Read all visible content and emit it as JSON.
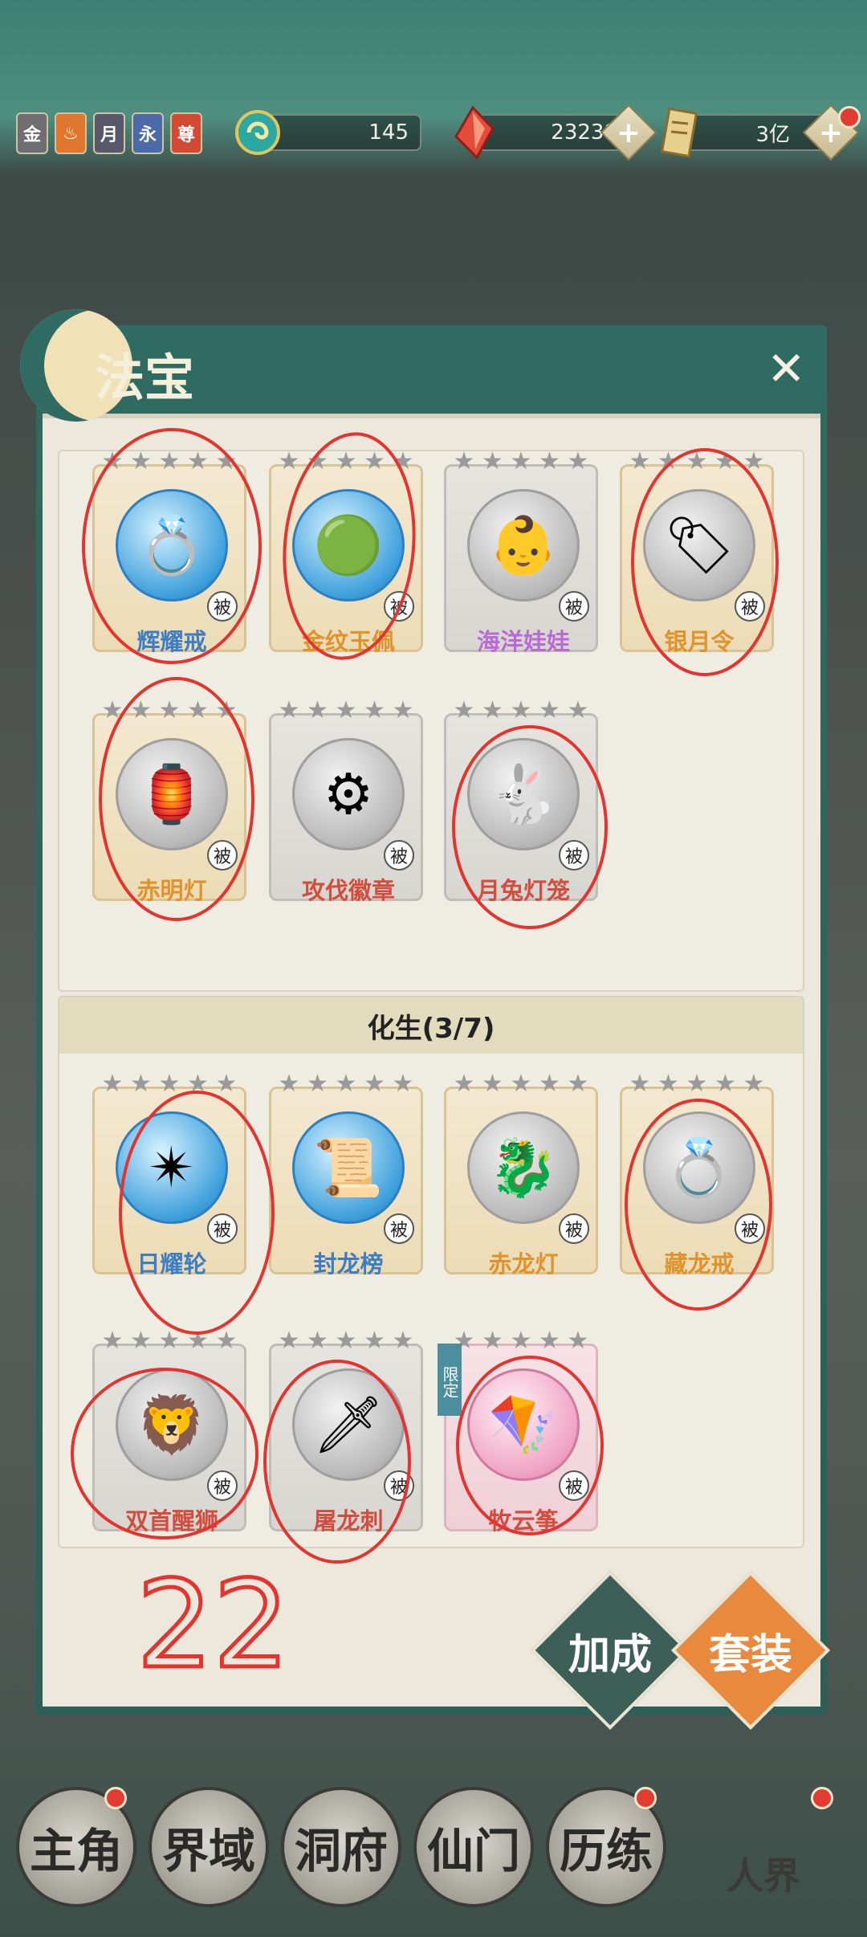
{
  "topbar": {
    "badges": [
      {
        "label": "金",
        "color": "#6f6f72",
        "icon": "gold-badge-icon"
      },
      {
        "label": "♨",
        "color": "#e1772f",
        "icon": "flame-badge-icon"
      },
      {
        "label": "月",
        "color": "#59586b",
        "icon": "moon-badge-icon"
      },
      {
        "label": "永",
        "color": "#4d6aa8",
        "icon": "eternal-badge-icon"
      },
      {
        "label": "尊",
        "color": "#d24a34",
        "icon": "honor-badge-icon"
      }
    ],
    "resources": [
      {
        "value": "145",
        "icon": "jade-swirl-icon"
      },
      {
        "value": "23238",
        "icon": "red-crystal-icon",
        "plus": "+"
      },
      {
        "value": "3亿",
        "icon": "scroll-icon",
        "plus": "+"
      }
    ]
  },
  "panel": {
    "title": "法宝",
    "close": "✕"
  },
  "section1": {
    "items": [
      {
        "name": "辉耀戒",
        "color": "blue",
        "orb": "blue",
        "glyph": "💍",
        "pass": "被"
      },
      {
        "name": "金纹玉佩",
        "color": "orange",
        "orb": "blue",
        "glyph": "🟢",
        "pass": "被"
      },
      {
        "name": "海洋娃娃",
        "color": "purple",
        "orb": "grey",
        "glyph": "👶",
        "pass": "被"
      },
      {
        "name": "银月令",
        "color": "orange",
        "orb": "grey",
        "glyph": "🏷",
        "pass": "被"
      },
      {
        "name": "赤明灯",
        "color": "orange",
        "orb": "grey",
        "glyph": "🏮",
        "pass": "被"
      },
      {
        "name": "攻伐徽章",
        "color": "red",
        "orb": "grey",
        "glyph": "⚙",
        "pass": "被"
      },
      {
        "name": "月兔灯笼",
        "color": "red",
        "orb": "grey",
        "glyph": "🐇",
        "pass": "被"
      }
    ]
  },
  "section2": {
    "header": "化生(3/7)",
    "limited_label": "限定",
    "items": [
      {
        "name": "日耀轮",
        "color": "blue",
        "orb": "blue",
        "glyph": "✴",
        "pass": "被"
      },
      {
        "name": "封龙榜",
        "color": "blue",
        "orb": "blue",
        "glyph": "📜",
        "pass": "被"
      },
      {
        "name": "赤龙灯",
        "color": "orange",
        "orb": "grey",
        "glyph": "🐉",
        "pass": "被"
      },
      {
        "name": "藏龙戒",
        "color": "orange",
        "orb": "grey",
        "glyph": "💍",
        "pass": "被"
      },
      {
        "name": "双首醒狮",
        "color": "red",
        "orb": "grey",
        "glyph": "🦁",
        "pass": "被"
      },
      {
        "name": "屠龙刺",
        "color": "red",
        "orb": "grey",
        "glyph": "🗡",
        "pass": "被"
      },
      {
        "name": "牧云筝",
        "color": "red",
        "orb": "pink",
        "glyph": "🪁",
        "pass": "被"
      }
    ]
  },
  "actions": {
    "bonus": "加成",
    "set": "套装",
    "bonus_color": "#3e5f58",
    "set_color": "#e8893e"
  },
  "bottom_nav": [
    {
      "label": "主角"
    },
    {
      "label": "界域"
    },
    {
      "label": "洞府"
    },
    {
      "label": "仙门"
    },
    {
      "label": "历练"
    }
  ],
  "bottom_nav_right": "人界",
  "annotation_note": "22"
}
